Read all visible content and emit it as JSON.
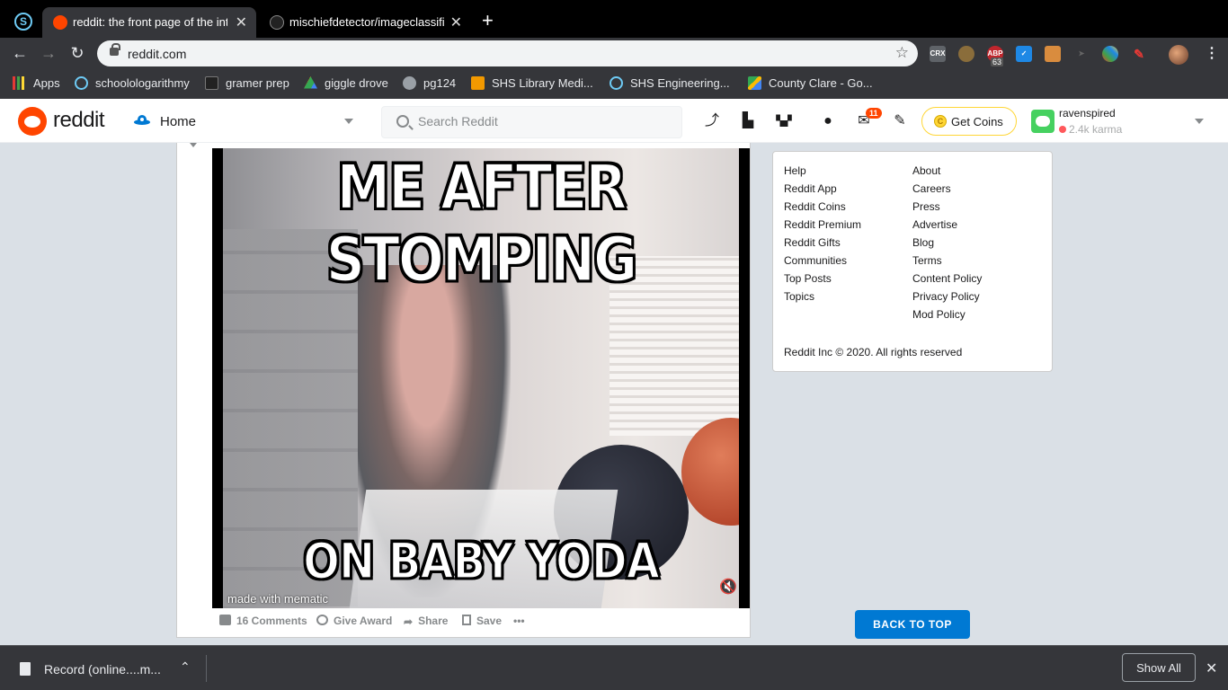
{
  "browser": {
    "tabs": [
      {
        "title": "reddit: the front page of the internet",
        "active": true
      },
      {
        "title": "mischiefdetector/imageclassifier",
        "active": false
      }
    ],
    "url": "reddit.com",
    "extension_badge": "63",
    "bookmarks": [
      {
        "label": "Apps",
        "icon": "apps-grid-icon"
      },
      {
        "label": "schoolologarithmy",
        "icon": "schoology-icon"
      },
      {
        "label": "gramer prep",
        "icon": "gb-icon"
      },
      {
        "label": "giggle drove",
        "icon": "drive-icon"
      },
      {
        "label": "pg124",
        "icon": "globe-icon"
      },
      {
        "label": "SHS Library Medi...",
        "icon": "library-icon"
      },
      {
        "label": "SHS Engineering...",
        "icon": "schoology-icon"
      },
      {
        "label": "County Clare - Go...",
        "icon": "maps-icon"
      }
    ]
  },
  "reddit": {
    "brand": "reddit",
    "home_label": "Home",
    "search_placeholder": "Search Reddit",
    "notification_count": "11",
    "get_coins_label": "Get Coins",
    "username": "ravenspired",
    "karma": "2.4k karma",
    "accent_color": "#ff4500",
    "button_color": "#0079d3"
  },
  "post": {
    "meme_top_text": "ME AFTER STOMPING",
    "meme_bottom_text": "ON BABY YODA",
    "watermark": "made with mematic",
    "actions": {
      "comments": "16 Comments",
      "award": "Give Award",
      "share": "Share",
      "save": "Save",
      "more": "•••"
    }
  },
  "sidebar": {
    "left_links": [
      "Help",
      "Reddit App",
      "Reddit Coins",
      "Reddit Premium",
      "Reddit Gifts",
      "Communities",
      "Top Posts",
      "Topics"
    ],
    "right_links": [
      "About",
      "Careers",
      "Press",
      "Advertise",
      "Blog",
      "Terms",
      "Content Policy",
      "Privacy Policy",
      "Mod Policy"
    ],
    "copyright": "Reddit Inc © 2020. All rights reserved",
    "back_to_top": "BACK TO TOP"
  },
  "downloads": {
    "file_name": "Record (online....m...",
    "show_all": "Show All"
  }
}
